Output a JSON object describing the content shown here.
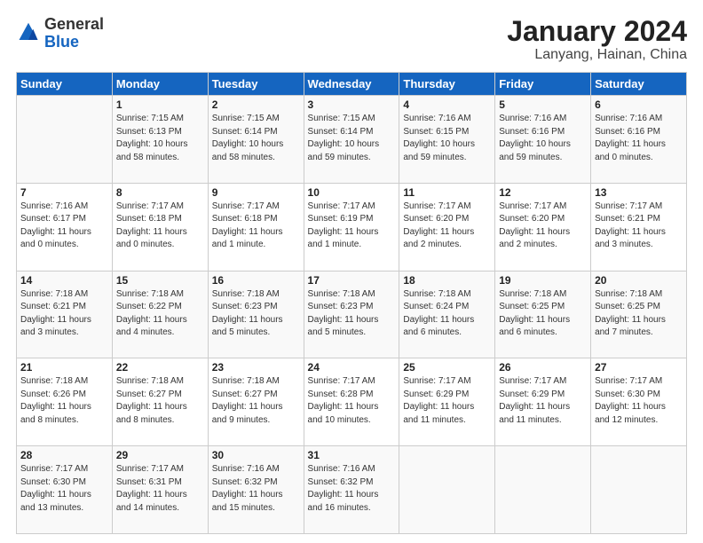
{
  "header": {
    "logo_general": "General",
    "logo_blue": "Blue",
    "title": "January 2024",
    "subtitle": "Lanyang, Hainan, China"
  },
  "columns": [
    "Sunday",
    "Monday",
    "Tuesday",
    "Wednesday",
    "Thursday",
    "Friday",
    "Saturday"
  ],
  "weeks": [
    [
      {
        "day": "",
        "info": ""
      },
      {
        "day": "1",
        "info": "Sunrise: 7:15 AM\nSunset: 6:13 PM\nDaylight: 10 hours\nand 58 minutes."
      },
      {
        "day": "2",
        "info": "Sunrise: 7:15 AM\nSunset: 6:14 PM\nDaylight: 10 hours\nand 58 minutes."
      },
      {
        "day": "3",
        "info": "Sunrise: 7:15 AM\nSunset: 6:14 PM\nDaylight: 10 hours\nand 59 minutes."
      },
      {
        "day": "4",
        "info": "Sunrise: 7:16 AM\nSunset: 6:15 PM\nDaylight: 10 hours\nand 59 minutes."
      },
      {
        "day": "5",
        "info": "Sunrise: 7:16 AM\nSunset: 6:16 PM\nDaylight: 10 hours\nand 59 minutes."
      },
      {
        "day": "6",
        "info": "Sunrise: 7:16 AM\nSunset: 6:16 PM\nDaylight: 11 hours\nand 0 minutes."
      }
    ],
    [
      {
        "day": "7",
        "info": "Sunrise: 7:16 AM\nSunset: 6:17 PM\nDaylight: 11 hours\nand 0 minutes."
      },
      {
        "day": "8",
        "info": "Sunrise: 7:17 AM\nSunset: 6:18 PM\nDaylight: 11 hours\nand 0 minutes."
      },
      {
        "day": "9",
        "info": "Sunrise: 7:17 AM\nSunset: 6:18 PM\nDaylight: 11 hours\nand 1 minute."
      },
      {
        "day": "10",
        "info": "Sunrise: 7:17 AM\nSunset: 6:19 PM\nDaylight: 11 hours\nand 1 minute."
      },
      {
        "day": "11",
        "info": "Sunrise: 7:17 AM\nSunset: 6:20 PM\nDaylight: 11 hours\nand 2 minutes."
      },
      {
        "day": "12",
        "info": "Sunrise: 7:17 AM\nSunset: 6:20 PM\nDaylight: 11 hours\nand 2 minutes."
      },
      {
        "day": "13",
        "info": "Sunrise: 7:17 AM\nSunset: 6:21 PM\nDaylight: 11 hours\nand 3 minutes."
      }
    ],
    [
      {
        "day": "14",
        "info": "Sunrise: 7:18 AM\nSunset: 6:21 PM\nDaylight: 11 hours\nand 3 minutes."
      },
      {
        "day": "15",
        "info": "Sunrise: 7:18 AM\nSunset: 6:22 PM\nDaylight: 11 hours\nand 4 minutes."
      },
      {
        "day": "16",
        "info": "Sunrise: 7:18 AM\nSunset: 6:23 PM\nDaylight: 11 hours\nand 5 minutes."
      },
      {
        "day": "17",
        "info": "Sunrise: 7:18 AM\nSunset: 6:23 PM\nDaylight: 11 hours\nand 5 minutes."
      },
      {
        "day": "18",
        "info": "Sunrise: 7:18 AM\nSunset: 6:24 PM\nDaylight: 11 hours\nand 6 minutes."
      },
      {
        "day": "19",
        "info": "Sunrise: 7:18 AM\nSunset: 6:25 PM\nDaylight: 11 hours\nand 6 minutes."
      },
      {
        "day": "20",
        "info": "Sunrise: 7:18 AM\nSunset: 6:25 PM\nDaylight: 11 hours\nand 7 minutes."
      }
    ],
    [
      {
        "day": "21",
        "info": "Sunrise: 7:18 AM\nSunset: 6:26 PM\nDaylight: 11 hours\nand 8 minutes."
      },
      {
        "day": "22",
        "info": "Sunrise: 7:18 AM\nSunset: 6:27 PM\nDaylight: 11 hours\nand 8 minutes."
      },
      {
        "day": "23",
        "info": "Sunrise: 7:18 AM\nSunset: 6:27 PM\nDaylight: 11 hours\nand 9 minutes."
      },
      {
        "day": "24",
        "info": "Sunrise: 7:17 AM\nSunset: 6:28 PM\nDaylight: 11 hours\nand 10 minutes."
      },
      {
        "day": "25",
        "info": "Sunrise: 7:17 AM\nSunset: 6:29 PM\nDaylight: 11 hours\nand 11 minutes."
      },
      {
        "day": "26",
        "info": "Sunrise: 7:17 AM\nSunset: 6:29 PM\nDaylight: 11 hours\nand 11 minutes."
      },
      {
        "day": "27",
        "info": "Sunrise: 7:17 AM\nSunset: 6:30 PM\nDaylight: 11 hours\nand 12 minutes."
      }
    ],
    [
      {
        "day": "28",
        "info": "Sunrise: 7:17 AM\nSunset: 6:30 PM\nDaylight: 11 hours\nand 13 minutes."
      },
      {
        "day": "29",
        "info": "Sunrise: 7:17 AM\nSunset: 6:31 PM\nDaylight: 11 hours\nand 14 minutes."
      },
      {
        "day": "30",
        "info": "Sunrise: 7:16 AM\nSunset: 6:32 PM\nDaylight: 11 hours\nand 15 minutes."
      },
      {
        "day": "31",
        "info": "Sunrise: 7:16 AM\nSunset: 6:32 PM\nDaylight: 11 hours\nand 16 minutes."
      },
      {
        "day": "",
        "info": ""
      },
      {
        "day": "",
        "info": ""
      },
      {
        "day": "",
        "info": ""
      }
    ]
  ]
}
